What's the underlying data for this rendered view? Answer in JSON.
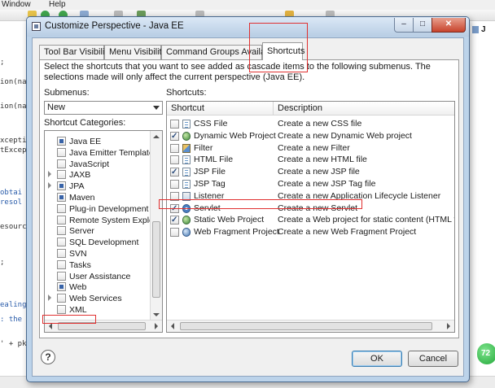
{
  "ide": {
    "menu": [
      "Window",
      "Help"
    ],
    "editor_lines": [
      ";",
      "ion(na",
      "ion(na",
      "xceptio",
      "tExcep",
      "obtai",
      "resol",
      "esource",
      ";",
      "ealing",
      ": the s",
      "' + pkg"
    ],
    "right_text": "J",
    "badge": "72"
  },
  "dialog": {
    "title": "Customize Perspective - Java EE",
    "close_glyph": "✕",
    "minimize_glyph": "–",
    "maximize_glyph": "□"
  },
  "tabs": [
    {
      "label": "Tool Bar Visibility"
    },
    {
      "label": "Menu Visibility"
    },
    {
      "label": "Command Groups Availability"
    },
    {
      "label": "Shortcuts"
    }
  ],
  "shortcuts_panel": {
    "description": "Select the shortcuts that you want to see added as cascade items to the following submenus.  The selections made will only affect the current perspective (Java EE).",
    "submenus_label": "Submenus:",
    "submenu_value": "New",
    "categories_label": "Shortcut Categories:",
    "shortcuts_label": "Shortcuts:",
    "categories": [
      {
        "label": "Java EE",
        "state": "filled",
        "expander": false
      },
      {
        "label": "Java Emitter Templates",
        "state": "empty",
        "expander": false
      },
      {
        "label": "JavaScript",
        "state": "empty",
        "expander": false
      },
      {
        "label": "JAXB",
        "state": "empty",
        "expander": true
      },
      {
        "label": "JPA",
        "state": "filled",
        "expander": true
      },
      {
        "label": "Maven",
        "state": "filled",
        "expander": false
      },
      {
        "label": "Plug-in Development",
        "state": "empty",
        "expander": false
      },
      {
        "label": "Remote System Explorer",
        "state": "empty",
        "expander": false
      },
      {
        "label": "Server",
        "state": "empty",
        "expander": false
      },
      {
        "label": "SQL Development",
        "state": "empty",
        "expander": false
      },
      {
        "label": "SVN",
        "state": "empty",
        "expander": false
      },
      {
        "label": "Tasks",
        "state": "empty",
        "expander": false
      },
      {
        "label": "User Assistance",
        "state": "empty",
        "expander": false
      },
      {
        "label": "Web",
        "state": "filled",
        "expander": false
      },
      {
        "label": "Web Services",
        "state": "empty",
        "expander": true
      },
      {
        "label": "XML",
        "state": "empty",
        "expander": false
      }
    ],
    "columns": {
      "shortcut": "Shortcut",
      "description": "Description"
    },
    "shortcuts": [
      {
        "name": "CSS File",
        "description": "Create a new CSS file",
        "checked": false,
        "icon": "css-file-icon"
      },
      {
        "name": "Dynamic Web Project",
        "description": "Create a new Dynamic Web project",
        "checked": true,
        "icon": "globe-icon"
      },
      {
        "name": "Filter",
        "description": "Create a new Filter",
        "checked": false,
        "icon": "filter-icon"
      },
      {
        "name": "HTML File",
        "description": "Create a new HTML file",
        "checked": false,
        "icon": "html-file-icon"
      },
      {
        "name": "JSP File",
        "description": "Create a new JSP file",
        "checked": true,
        "icon": "jsp-file-icon"
      },
      {
        "name": "JSP Tag",
        "description": "Create a new JSP Tag file",
        "checked": false,
        "icon": "jsp-tag-icon"
      },
      {
        "name": "Listener",
        "description": "Create a new Application Lifecycle Listener",
        "checked": false,
        "icon": "listener-icon"
      },
      {
        "name": "Servlet",
        "description": "Create a new Servlet",
        "checked": true,
        "icon": "servlet-gear-icon"
      },
      {
        "name": "Static Web Project",
        "description": "Create a Web project for static content (HTML files) o",
        "checked": true,
        "icon": "static-web-project-icon"
      },
      {
        "name": "Web Fragment Project",
        "description": "Create a new Web Fragment Project",
        "checked": false,
        "icon": "web-fragment-icon"
      }
    ]
  },
  "buttons": {
    "help": "?",
    "ok": "OK",
    "cancel": "Cancel"
  },
  "colors": {
    "annotation_red": "#e03030",
    "title_bar": "#b8cde4",
    "check_blue": "#3863a8"
  }
}
